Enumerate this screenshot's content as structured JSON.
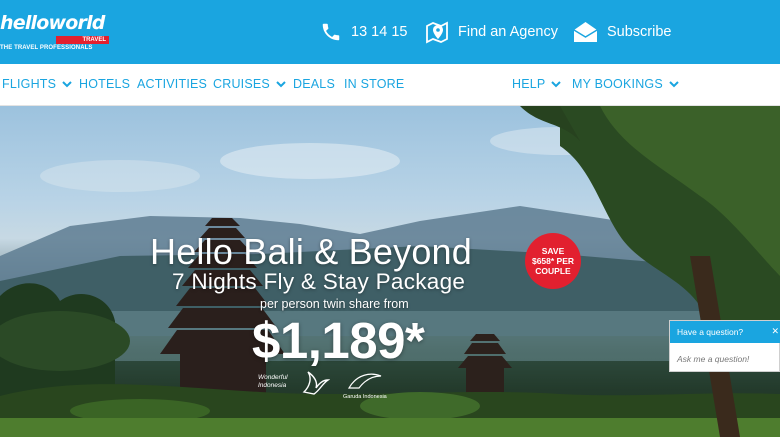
{
  "brand": {
    "logo_text": "helloworld",
    "logo_badge": "TRAVEL",
    "tagline": "THE TRAVEL PROFESSIONALS"
  },
  "header": {
    "phone": "13 14 15",
    "find_agency": "Find an Agency",
    "subscribe": "Subscribe"
  },
  "nav": {
    "flights": "FLIGHTS",
    "hotels": "HOTELS",
    "activities": "ACTIVITIES",
    "cruises": "CRUISES",
    "deals": "DEALS",
    "in_store": "IN STORE",
    "help": "HELP",
    "my_bookings": "MY BOOKINGS"
  },
  "hero": {
    "title": "Hello Bali & Beyond",
    "subtitle": "7 Nights Fly & Stay Package",
    "price_note": "per person twin share from",
    "price": "$1,189*",
    "badge_line1": "SAVE",
    "badge_line2": "$658* PER",
    "badge_line3": "COUPLE",
    "partner1_line1": "Wonderful",
    "partner1_line2": "Indonesia",
    "partner2_line1": "Garuda Indonesia"
  },
  "chat": {
    "title": "Have a question?",
    "placeholder": "Ask me a question!"
  },
  "colors": {
    "brand_blue": "#1aa5e0",
    "accent_red": "#e2202f"
  },
  "icons": [
    "phone-icon",
    "map-pin-icon",
    "envelope-icon",
    "chevron-down-icon",
    "close-icon"
  ]
}
